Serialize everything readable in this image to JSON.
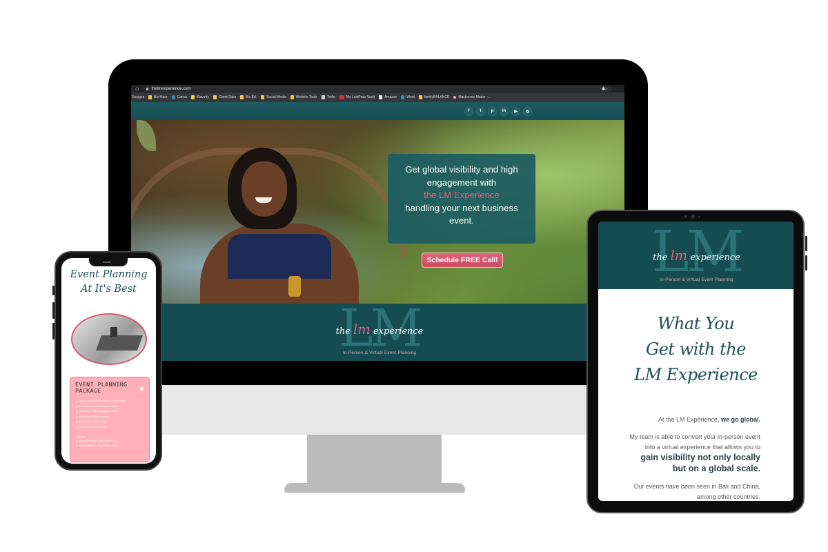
{
  "browser": {
    "url": "thelmexperience.com",
    "bookmarks": [
      {
        "label": "Designs",
        "icon": "none"
      },
      {
        "label": "Biz Mars",
        "icon": "folder-icon"
      },
      {
        "label": "Canva",
        "icon": "canva-icon"
      },
      {
        "label": "Waverly",
        "icon": "folder-icon"
      },
      {
        "label": "Client Sites",
        "icon": "folder-icon"
      },
      {
        "label": "Biz Ed.",
        "icon": "folder-icon"
      },
      {
        "label": "Social Media",
        "icon": "folder-icon"
      },
      {
        "label": "Website Tools",
        "icon": "folder-icon"
      },
      {
        "label": "Trello",
        "icon": "trello-icon"
      },
      {
        "label": "My LastPass Vault",
        "icon": "lastpass-icon"
      },
      {
        "label": "Amazon",
        "icon": "amazon-icon"
      },
      {
        "label": "Woot",
        "icon": "woot-icon"
      },
      {
        "label": "familyBALANCE",
        "icon": "folder-icon"
      },
      {
        "label": "Mackenzie Mader -...",
        "icon": "favicon-icon"
      }
    ],
    "home_icon": "⌂",
    "star_icon": "☆",
    "extension_icon": "✱"
  },
  "desktop_site": {
    "social_icons": [
      {
        "name": "facebook-icon",
        "glyph": "f"
      },
      {
        "name": "twitter-icon",
        "glyph": "t"
      },
      {
        "name": "pinterest-icon",
        "glyph": "p"
      },
      {
        "name": "linkedin-icon",
        "glyph": "in"
      },
      {
        "name": "youtube-icon",
        "glyph": "▶"
      },
      {
        "name": "instagram-icon",
        "glyph": "◎"
      }
    ],
    "hero_text_1": "Get global visibility and high engagement with",
    "hero_highlight": "the LM Experience",
    "hero_text_2": "handling your next business event.",
    "cta_label": "Schedule FREE Call!"
  },
  "logo": {
    "monogram": "LM",
    "script_prefix": "the",
    "script_accent": "lm",
    "script_suffix": "experience",
    "tagline": "In-Person & Virtual Event Planning"
  },
  "phone_site": {
    "title_line1": "Event Planning",
    "title_line2": "At It's Best",
    "package_title": "Event Planning Package",
    "package_items": [
      "Event Planning Sessions (2 per month)",
      "Email & Scheduled Phone Support",
      "Timeline + Event Agenda Creation",
      "Build Out of Virtual Venue",
      "Virtual Run of the Show",
      "Day of Event Execution"
    ],
    "addons_label": "Add-ons:",
    "addons": [
      "Event Strategy Consultation Call",
      "Simple Booth: Virtual Photo Booth"
    ]
  },
  "tablet_site": {
    "title_line1": "What You",
    "title_line2": "Get with the",
    "title_line3": "LM Experience",
    "p1_text": "At the LM Experience, ",
    "p1_bold": "we go global.",
    "p2_text": "My team is able to convert your in-person event into a virtual experience that allows you to ",
    "p2_bold": "gain visibility not only locally but on a global scale.",
    "p3_text": "Our events have been seen in Bali and China, among other countries."
  },
  "colors": {
    "brand_teal": "#154c52",
    "accent_pink": "#e2637a",
    "package_pink": "#ffb0b9"
  }
}
